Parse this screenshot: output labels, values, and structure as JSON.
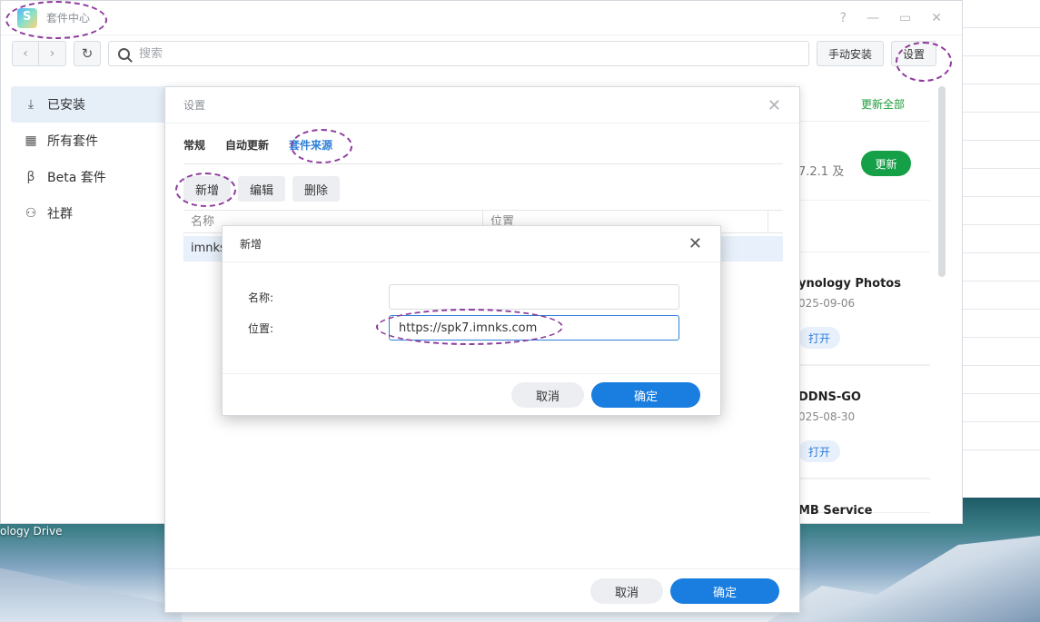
{
  "app": {
    "title": "套件中心"
  },
  "desktop": {
    "label": "ology Drive"
  },
  "toolbar": {
    "search_placeholder": "搜索",
    "manual_install": "手动安装",
    "settings": "设置"
  },
  "sidebar": {
    "items": [
      {
        "label": "已安装"
      },
      {
        "label": "所有套件"
      },
      {
        "label": "Beta 套件"
      },
      {
        "label": "社群"
      }
    ]
  },
  "main": {
    "update_all": "更新全部",
    "first_card": {
      "version": "7.2.1 及",
      "update": "更新"
    },
    "packages": [
      {
        "name": "ynology Photos",
        "date": "025-09-06",
        "action": "打开"
      },
      {
        "name": "DDNS-GO",
        "date": "025-08-30",
        "action": "打开"
      },
      {
        "name": "MB Service"
      }
    ]
  },
  "settings_dialog": {
    "title": "设置",
    "tabs": [
      "常规",
      "自动更新",
      "套件来源"
    ],
    "buttons": {
      "add": "新增",
      "edit": "编辑",
      "delete": "删除"
    },
    "columns": {
      "name": "名称",
      "location": "位置"
    },
    "rows": [
      {
        "name": "imnks"
      }
    ],
    "cancel": "取消",
    "ok": "确定"
  },
  "new_source_dialog": {
    "title": "新增",
    "name_label": "名称:",
    "name_value": "",
    "location_label": "位置:",
    "location_value": "https://spk7.imnks.com",
    "cancel": "取消",
    "ok": "确定"
  },
  "colors": {
    "accent": "#1a7ee0",
    "update_green": "#15a048",
    "annotation": "#8e3a9c"
  }
}
